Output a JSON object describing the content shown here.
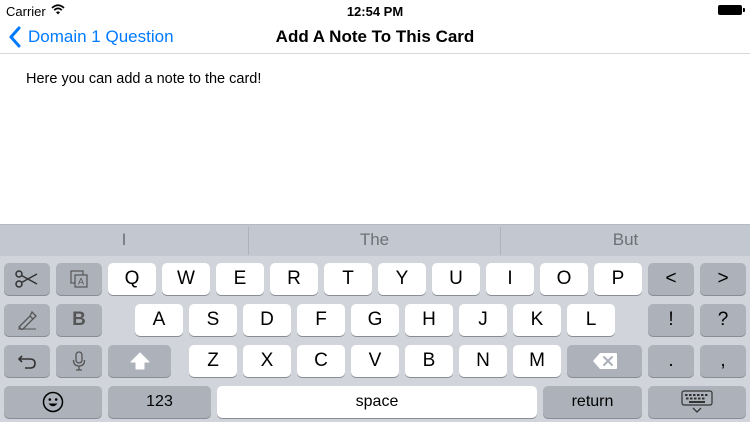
{
  "status_bar": {
    "carrier": "Carrier",
    "time": "12:54 PM"
  },
  "nav": {
    "back_label": "Domain 1 Question",
    "title": "Add A Note To This Card"
  },
  "note": {
    "text": "Here you can add a note to the card!"
  },
  "keyboard": {
    "suggestions": [
      "I",
      "The",
      "But"
    ],
    "row1": [
      "Q",
      "W",
      "E",
      "R",
      "T",
      "Y",
      "U",
      "I",
      "O",
      "P"
    ],
    "row2": [
      "A",
      "S",
      "D",
      "F",
      "G",
      "H",
      "J",
      "K",
      "L"
    ],
    "row3": [
      "Z",
      "X",
      "C",
      "V",
      "B",
      "N",
      "M"
    ],
    "bold_label": "B",
    "left_label": "<",
    "right_label": ">",
    "exclaim_label": "!",
    "question_label": "?",
    "period_label": ".",
    "comma_label": ",",
    "numbers_label": "123",
    "space_label": "space",
    "return_label": "return",
    "icons": {
      "cut": "scissors-icon",
      "copy": "copy-icon",
      "paste": "paste-icon",
      "undo": "undo-icon",
      "dictation": "microphone-icon",
      "shift": "shift-icon",
      "delete": "backspace-icon",
      "emoji": "emoji-icon",
      "dismiss": "keyboard-dismiss-icon"
    }
  }
}
